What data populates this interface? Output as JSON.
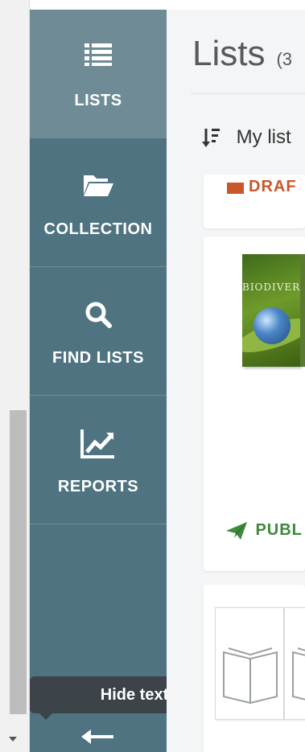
{
  "sidebar": {
    "items": [
      {
        "label": "LISTS",
        "icon": "list-icon",
        "active": true
      },
      {
        "label": "COLLECTION",
        "icon": "folder-open-icon",
        "active": false
      },
      {
        "label": "FIND LISTS",
        "icon": "search-icon",
        "active": false
      },
      {
        "label": "REPORTS",
        "icon": "chart-line-icon",
        "active": false
      }
    ],
    "tooltip": "Hide text",
    "collapse_icon": "arrow-left-icon"
  },
  "main": {
    "title": "Lists",
    "count": "(3",
    "sort_label": "My list",
    "cards": [
      {
        "status": "DRAF",
        "status_color": "#c8582a"
      },
      {
        "book_title": "BIODIVERS",
        "status": "PUBL",
        "status_color": "#3c8a3b"
      },
      {
        "placeholder": true
      }
    ]
  },
  "colors": {
    "sidebar": "#4f7380",
    "sidebar_active": "#6f8c96",
    "main_bg": "#f3f5f6",
    "tooltip_bg": "#3c4449"
  }
}
